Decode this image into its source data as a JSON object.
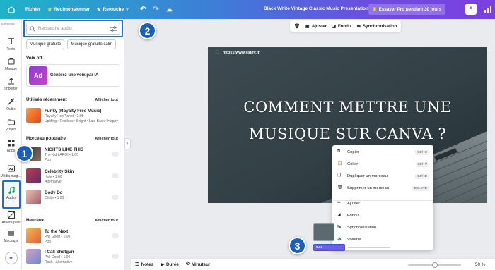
{
  "topbar": {
    "file_label": "Fichier",
    "resize_label": "Redimensionner",
    "edit_label": "Retouche",
    "doc_title": "Black White Vintage Classic Music Presentation",
    "pro_label": "Essayer Pro pendant 30 jours",
    "avatar_initials": "A",
    "accent_colors": [
      "#1fb3c9",
      "#6d4de0"
    ]
  },
  "rail": {
    "items": [
      {
        "label": "Eléments",
        "icon": "shapes-icon"
      },
      {
        "label": "Texte",
        "icon": "text-icon"
      },
      {
        "label": "Marque",
        "icon": "brand-icon"
      },
      {
        "label": "Importer",
        "icon": "upload-icon"
      },
      {
        "label": "Outils",
        "icon": "tools-icon"
      },
      {
        "label": "Projets",
        "icon": "folder-icon"
      },
      {
        "label": "Apps",
        "icon": "apps-icon"
      },
      {
        "label": "Média magi...",
        "icon": "magic-media-icon"
      },
      {
        "label": "Audio",
        "icon": "music-note-icon"
      },
      {
        "label": "Arrière-plan",
        "icon": "background-icon"
      },
      {
        "label": "Mockups",
        "icon": "mockups-icon"
      }
    ],
    "active": "Audio"
  },
  "panel": {
    "search_placeholder": "Recherche audio",
    "chips": [
      "Musique gratuite",
      "Musique gratuite calm"
    ],
    "voice_section": "Voix off",
    "voice_card": "Générez une voix par IA",
    "voice_thumb": "Ad",
    "recent_section": "Utilisés récemment",
    "popular_section": "Morceau populaire",
    "happy_section": "Heureux",
    "show_all": "Afficher tout",
    "recent": [
      {
        "title": "Funky (Royalty Free Music)",
        "artist": "RoyaltyFreePlanet • 2:08",
        "tags": "Upliftng • Restless • Bright • Laid Back • Happy"
      }
    ],
    "popular": [
      {
        "title": "NIGHTS LIKE THIS",
        "artist": "The Kid LAROI • 1:00",
        "tags": "Pop"
      },
      {
        "title": "Celebrity Skin",
        "artist": "Hole • 1:00",
        "tags": "Alternative"
      },
      {
        "title": "Body Do",
        "artist": "Chlöe • 1:00",
        "tags": ""
      }
    ],
    "happy": [
      {
        "title": "To the Next",
        "artist": "Phil Good • 1:00",
        "tags": "Pop"
      },
      {
        "title": "I Call Shotgun",
        "artist": "Phil Good • 1:00",
        "tags": "Rock • Alternative"
      }
    ]
  },
  "toolbar": {
    "adjust_label": "Ajuster",
    "fade_label": "Fondu",
    "sync_label": "Synchronisation"
  },
  "canvas": {
    "url": "https://www.sidify.fr/",
    "title_line1": "COMMENT METTRE UNE",
    "title_line2": "MUSIQUE SUR CANVA ?"
  },
  "context_menu": {
    "items": [
      {
        "label": "Copier",
        "shortcut": "Ctrl+C",
        "icon": "copy-icon"
      },
      {
        "label": "Coller",
        "shortcut": "Ctrl+V",
        "icon": "paste-icon"
      },
      {
        "label": "Dupliquer un morceau",
        "shortcut": "Ctrl+D",
        "icon": "duplicate-icon"
      },
      {
        "label": "Supprimer un morceau",
        "shortcut": "DELETE",
        "icon": "trash-icon"
      },
      {
        "label": "Ajuster",
        "shortcut": "",
        "icon": "scissors-icon"
      },
      {
        "label": "Fondu",
        "shortcut": "",
        "icon": "fade-icon"
      },
      {
        "label": "Synchronisation",
        "shortcut": "",
        "icon": "sync-icon"
      },
      {
        "label": "Volume",
        "shortcut": "",
        "icon": "volume-icon"
      }
    ]
  },
  "timeline": {
    "audio_duration": "5.0s"
  },
  "badges": [
    "1",
    "2",
    "3"
  ],
  "bottombar": {
    "notes_label": "Notes",
    "duration_label": "Durée",
    "timer_label": "Minuteur",
    "zoom": "50 %",
    "zoom_level": 0.5
  }
}
